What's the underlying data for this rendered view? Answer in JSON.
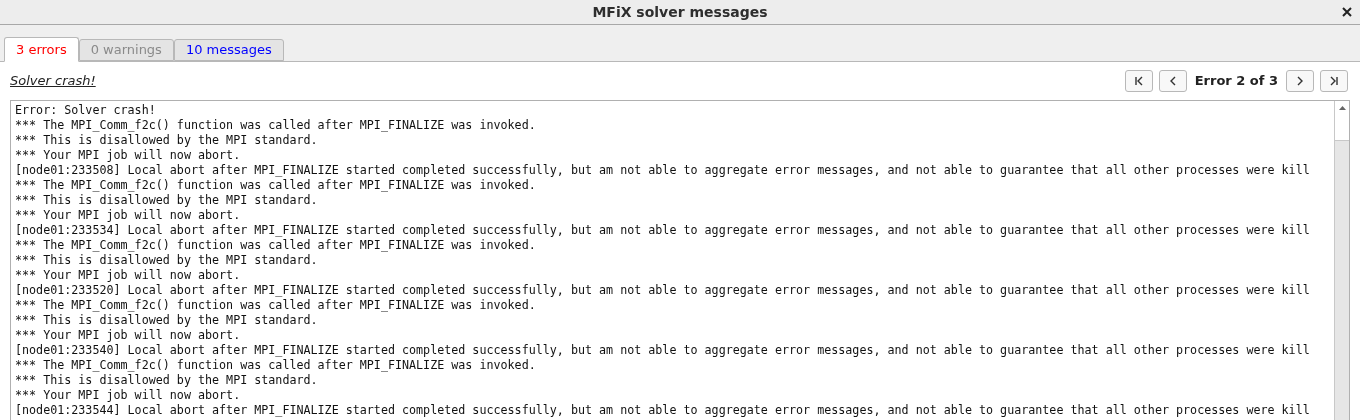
{
  "window": {
    "title": "MFiX solver messages"
  },
  "tabs": [
    {
      "label": "3 errors",
      "kind": "error",
      "selected": true
    },
    {
      "label": "0 warnings",
      "kind": "warning",
      "selected": false
    },
    {
      "label": "10 messages",
      "kind": "message",
      "selected": false
    }
  ],
  "summary": "Solver crash!",
  "navigator": {
    "position": "Error 2 of 3"
  },
  "log_lines": [
    "Error: Solver crash!",
    "*** The MPI_Comm_f2c() function was called after MPI_FINALIZE was invoked.",
    "*** This is disallowed by the MPI standard.",
    "*** Your MPI job will now abort.",
    "[node01:233508] Local abort after MPI_FINALIZE started completed successfully, but am not able to aggregate error messages, and not able to guarantee that all other processes were kill",
    "*** The MPI_Comm_f2c() function was called after MPI_FINALIZE was invoked.",
    "*** This is disallowed by the MPI standard.",
    "*** Your MPI job will now abort.",
    "[node01:233534] Local abort after MPI_FINALIZE started completed successfully, but am not able to aggregate error messages, and not able to guarantee that all other processes were kill",
    "*** The MPI_Comm_f2c() function was called after MPI_FINALIZE was invoked.",
    "*** This is disallowed by the MPI standard.",
    "*** Your MPI job will now abort.",
    "[node01:233520] Local abort after MPI_FINALIZE started completed successfully, but am not able to aggregate error messages, and not able to guarantee that all other processes were kill",
    "*** The MPI_Comm_f2c() function was called after MPI_FINALIZE was invoked.",
    "*** This is disallowed by the MPI standard.",
    "*** Your MPI job will now abort.",
    "[node01:233540] Local abort after MPI_FINALIZE started completed successfully, but am not able to aggregate error messages, and not able to guarantee that all other processes were kill",
    "*** The MPI_Comm_f2c() function was called after MPI_FINALIZE was invoked.",
    "*** This is disallowed by the MPI standard.",
    "*** Your MPI job will now abort.",
    "[node01:233544] Local abort after MPI_FINALIZE started completed successfully, but am not able to aggregate error messages, and not able to guarantee that all other processes were kill"
  ]
}
